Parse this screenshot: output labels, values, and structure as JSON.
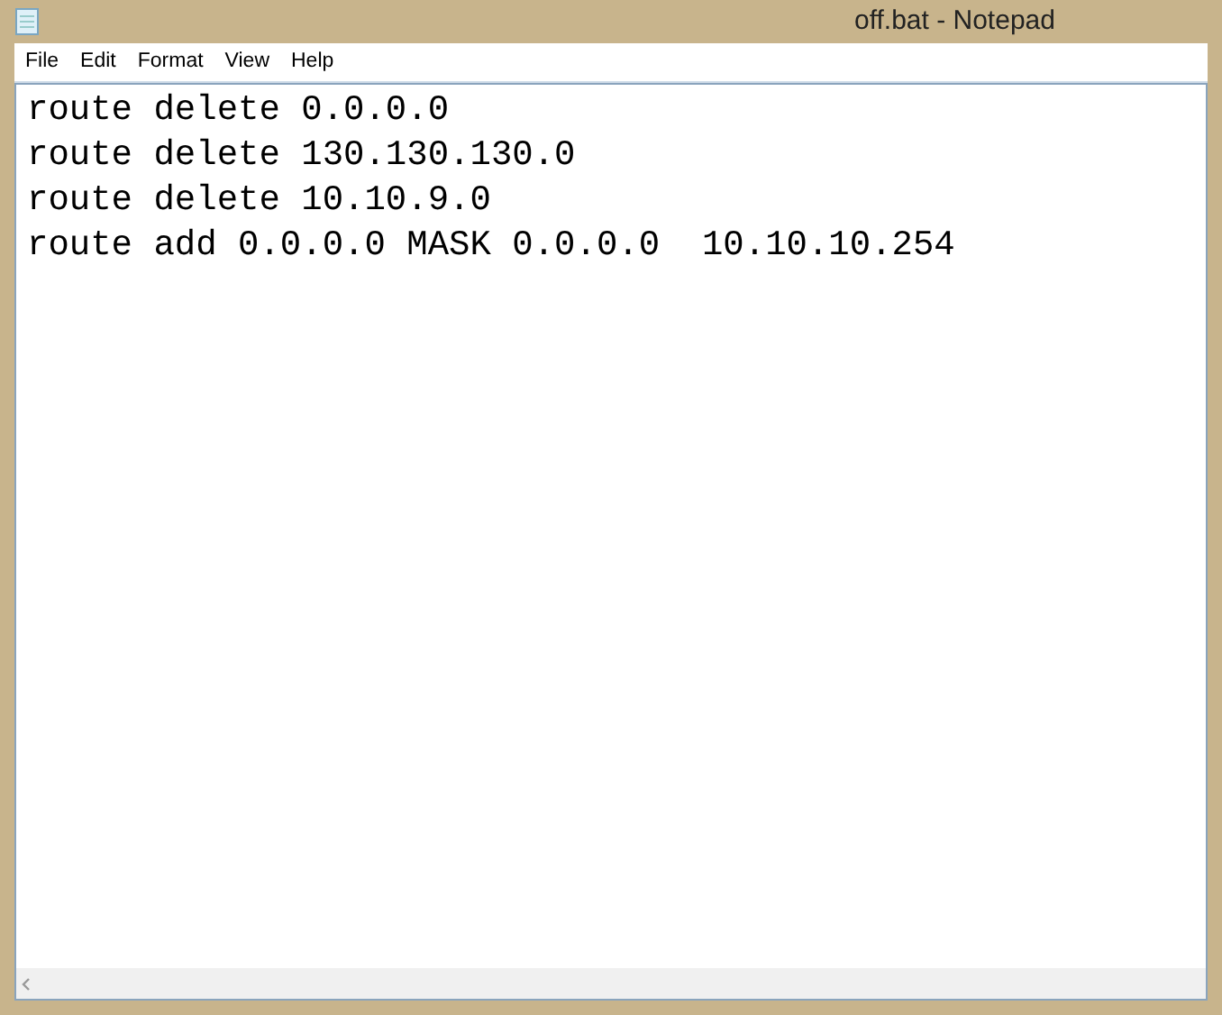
{
  "window": {
    "title": "off.bat - Notepad"
  },
  "menu": [
    "File",
    "Edit",
    "Format",
    "View",
    "Help"
  ],
  "editor": {
    "lines": [
      "route delete 0.0.0.0",
      "route delete 130.130.130.0",
      "route delete 10.10.9.0",
      "route add 0.0.0.0 MASK 0.0.0.0  10.10.10.254"
    ]
  }
}
